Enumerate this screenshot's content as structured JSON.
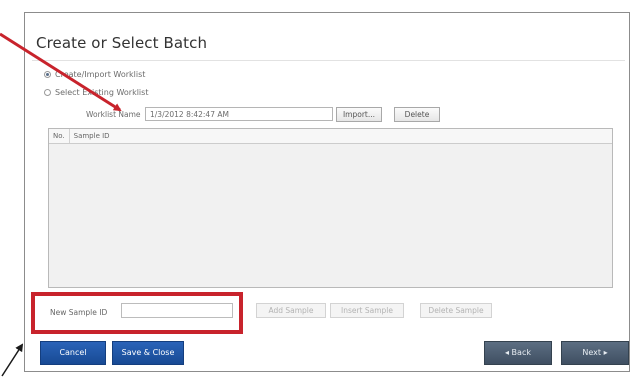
{
  "dialog": {
    "title": "Create or Select Batch"
  },
  "options": {
    "create_import_label": "Create/Import Worklist",
    "select_existing_label": "Select Existing Worklist",
    "selected": "create_import"
  },
  "worklist": {
    "name_label": "Worklist Name",
    "name_value": "1/3/2012 8:42:47 AM",
    "import_label": "Import...",
    "delete_label": "Delete"
  },
  "grid": {
    "columns": [
      "No.",
      "Sample ID"
    ],
    "rows": []
  },
  "sample_entry": {
    "label": "New Sample ID",
    "value": "",
    "add_label": "Add Sample",
    "insert_label": "Insert Sample",
    "delete_label": "Delete Sample"
  },
  "footer": {
    "cancel_label": "Cancel",
    "save_close_label": "Save & Close",
    "back_label": "◂ Back",
    "next_label": "Next ▸"
  },
  "colors": {
    "highlight": "#c8232c",
    "primary_button": "#1f56a6",
    "nav_button": "#4d5e72"
  }
}
